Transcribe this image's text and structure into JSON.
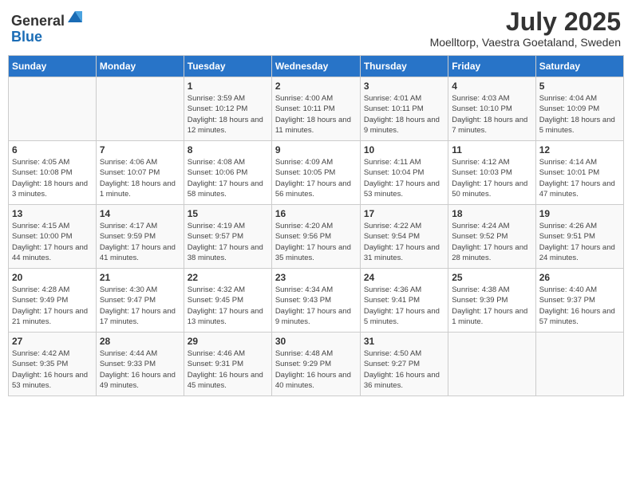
{
  "header": {
    "logo_general": "General",
    "logo_blue": "Blue",
    "month_title": "July 2025",
    "location": "Moelltorp, Vaestra Goetaland, Sweden"
  },
  "days_of_week": [
    "Sunday",
    "Monday",
    "Tuesday",
    "Wednesday",
    "Thursday",
    "Friday",
    "Saturday"
  ],
  "weeks": [
    [
      {
        "day": "",
        "detail": ""
      },
      {
        "day": "",
        "detail": ""
      },
      {
        "day": "1",
        "detail": "Sunrise: 3:59 AM\nSunset: 10:12 PM\nDaylight: 18 hours and 12 minutes."
      },
      {
        "day": "2",
        "detail": "Sunrise: 4:00 AM\nSunset: 10:11 PM\nDaylight: 18 hours and 11 minutes."
      },
      {
        "day": "3",
        "detail": "Sunrise: 4:01 AM\nSunset: 10:11 PM\nDaylight: 18 hours and 9 minutes."
      },
      {
        "day": "4",
        "detail": "Sunrise: 4:03 AM\nSunset: 10:10 PM\nDaylight: 18 hours and 7 minutes."
      },
      {
        "day": "5",
        "detail": "Sunrise: 4:04 AM\nSunset: 10:09 PM\nDaylight: 18 hours and 5 minutes."
      }
    ],
    [
      {
        "day": "6",
        "detail": "Sunrise: 4:05 AM\nSunset: 10:08 PM\nDaylight: 18 hours and 3 minutes."
      },
      {
        "day": "7",
        "detail": "Sunrise: 4:06 AM\nSunset: 10:07 PM\nDaylight: 18 hours and 1 minute."
      },
      {
        "day": "8",
        "detail": "Sunrise: 4:08 AM\nSunset: 10:06 PM\nDaylight: 17 hours and 58 minutes."
      },
      {
        "day": "9",
        "detail": "Sunrise: 4:09 AM\nSunset: 10:05 PM\nDaylight: 17 hours and 56 minutes."
      },
      {
        "day": "10",
        "detail": "Sunrise: 4:11 AM\nSunset: 10:04 PM\nDaylight: 17 hours and 53 minutes."
      },
      {
        "day": "11",
        "detail": "Sunrise: 4:12 AM\nSunset: 10:03 PM\nDaylight: 17 hours and 50 minutes."
      },
      {
        "day": "12",
        "detail": "Sunrise: 4:14 AM\nSunset: 10:01 PM\nDaylight: 17 hours and 47 minutes."
      }
    ],
    [
      {
        "day": "13",
        "detail": "Sunrise: 4:15 AM\nSunset: 10:00 PM\nDaylight: 17 hours and 44 minutes."
      },
      {
        "day": "14",
        "detail": "Sunrise: 4:17 AM\nSunset: 9:59 PM\nDaylight: 17 hours and 41 minutes."
      },
      {
        "day": "15",
        "detail": "Sunrise: 4:19 AM\nSunset: 9:57 PM\nDaylight: 17 hours and 38 minutes."
      },
      {
        "day": "16",
        "detail": "Sunrise: 4:20 AM\nSunset: 9:56 PM\nDaylight: 17 hours and 35 minutes."
      },
      {
        "day": "17",
        "detail": "Sunrise: 4:22 AM\nSunset: 9:54 PM\nDaylight: 17 hours and 31 minutes."
      },
      {
        "day": "18",
        "detail": "Sunrise: 4:24 AM\nSunset: 9:52 PM\nDaylight: 17 hours and 28 minutes."
      },
      {
        "day": "19",
        "detail": "Sunrise: 4:26 AM\nSunset: 9:51 PM\nDaylight: 17 hours and 24 minutes."
      }
    ],
    [
      {
        "day": "20",
        "detail": "Sunrise: 4:28 AM\nSunset: 9:49 PM\nDaylight: 17 hours and 21 minutes."
      },
      {
        "day": "21",
        "detail": "Sunrise: 4:30 AM\nSunset: 9:47 PM\nDaylight: 17 hours and 17 minutes."
      },
      {
        "day": "22",
        "detail": "Sunrise: 4:32 AM\nSunset: 9:45 PM\nDaylight: 17 hours and 13 minutes."
      },
      {
        "day": "23",
        "detail": "Sunrise: 4:34 AM\nSunset: 9:43 PM\nDaylight: 17 hours and 9 minutes."
      },
      {
        "day": "24",
        "detail": "Sunrise: 4:36 AM\nSunset: 9:41 PM\nDaylight: 17 hours and 5 minutes."
      },
      {
        "day": "25",
        "detail": "Sunrise: 4:38 AM\nSunset: 9:39 PM\nDaylight: 17 hours and 1 minute."
      },
      {
        "day": "26",
        "detail": "Sunrise: 4:40 AM\nSunset: 9:37 PM\nDaylight: 16 hours and 57 minutes."
      }
    ],
    [
      {
        "day": "27",
        "detail": "Sunrise: 4:42 AM\nSunset: 9:35 PM\nDaylight: 16 hours and 53 minutes."
      },
      {
        "day": "28",
        "detail": "Sunrise: 4:44 AM\nSunset: 9:33 PM\nDaylight: 16 hours and 49 minutes."
      },
      {
        "day": "29",
        "detail": "Sunrise: 4:46 AM\nSunset: 9:31 PM\nDaylight: 16 hours and 45 minutes."
      },
      {
        "day": "30",
        "detail": "Sunrise: 4:48 AM\nSunset: 9:29 PM\nDaylight: 16 hours and 40 minutes."
      },
      {
        "day": "31",
        "detail": "Sunrise: 4:50 AM\nSunset: 9:27 PM\nDaylight: 16 hours and 36 minutes."
      },
      {
        "day": "",
        "detail": ""
      },
      {
        "day": "",
        "detail": ""
      }
    ]
  ]
}
